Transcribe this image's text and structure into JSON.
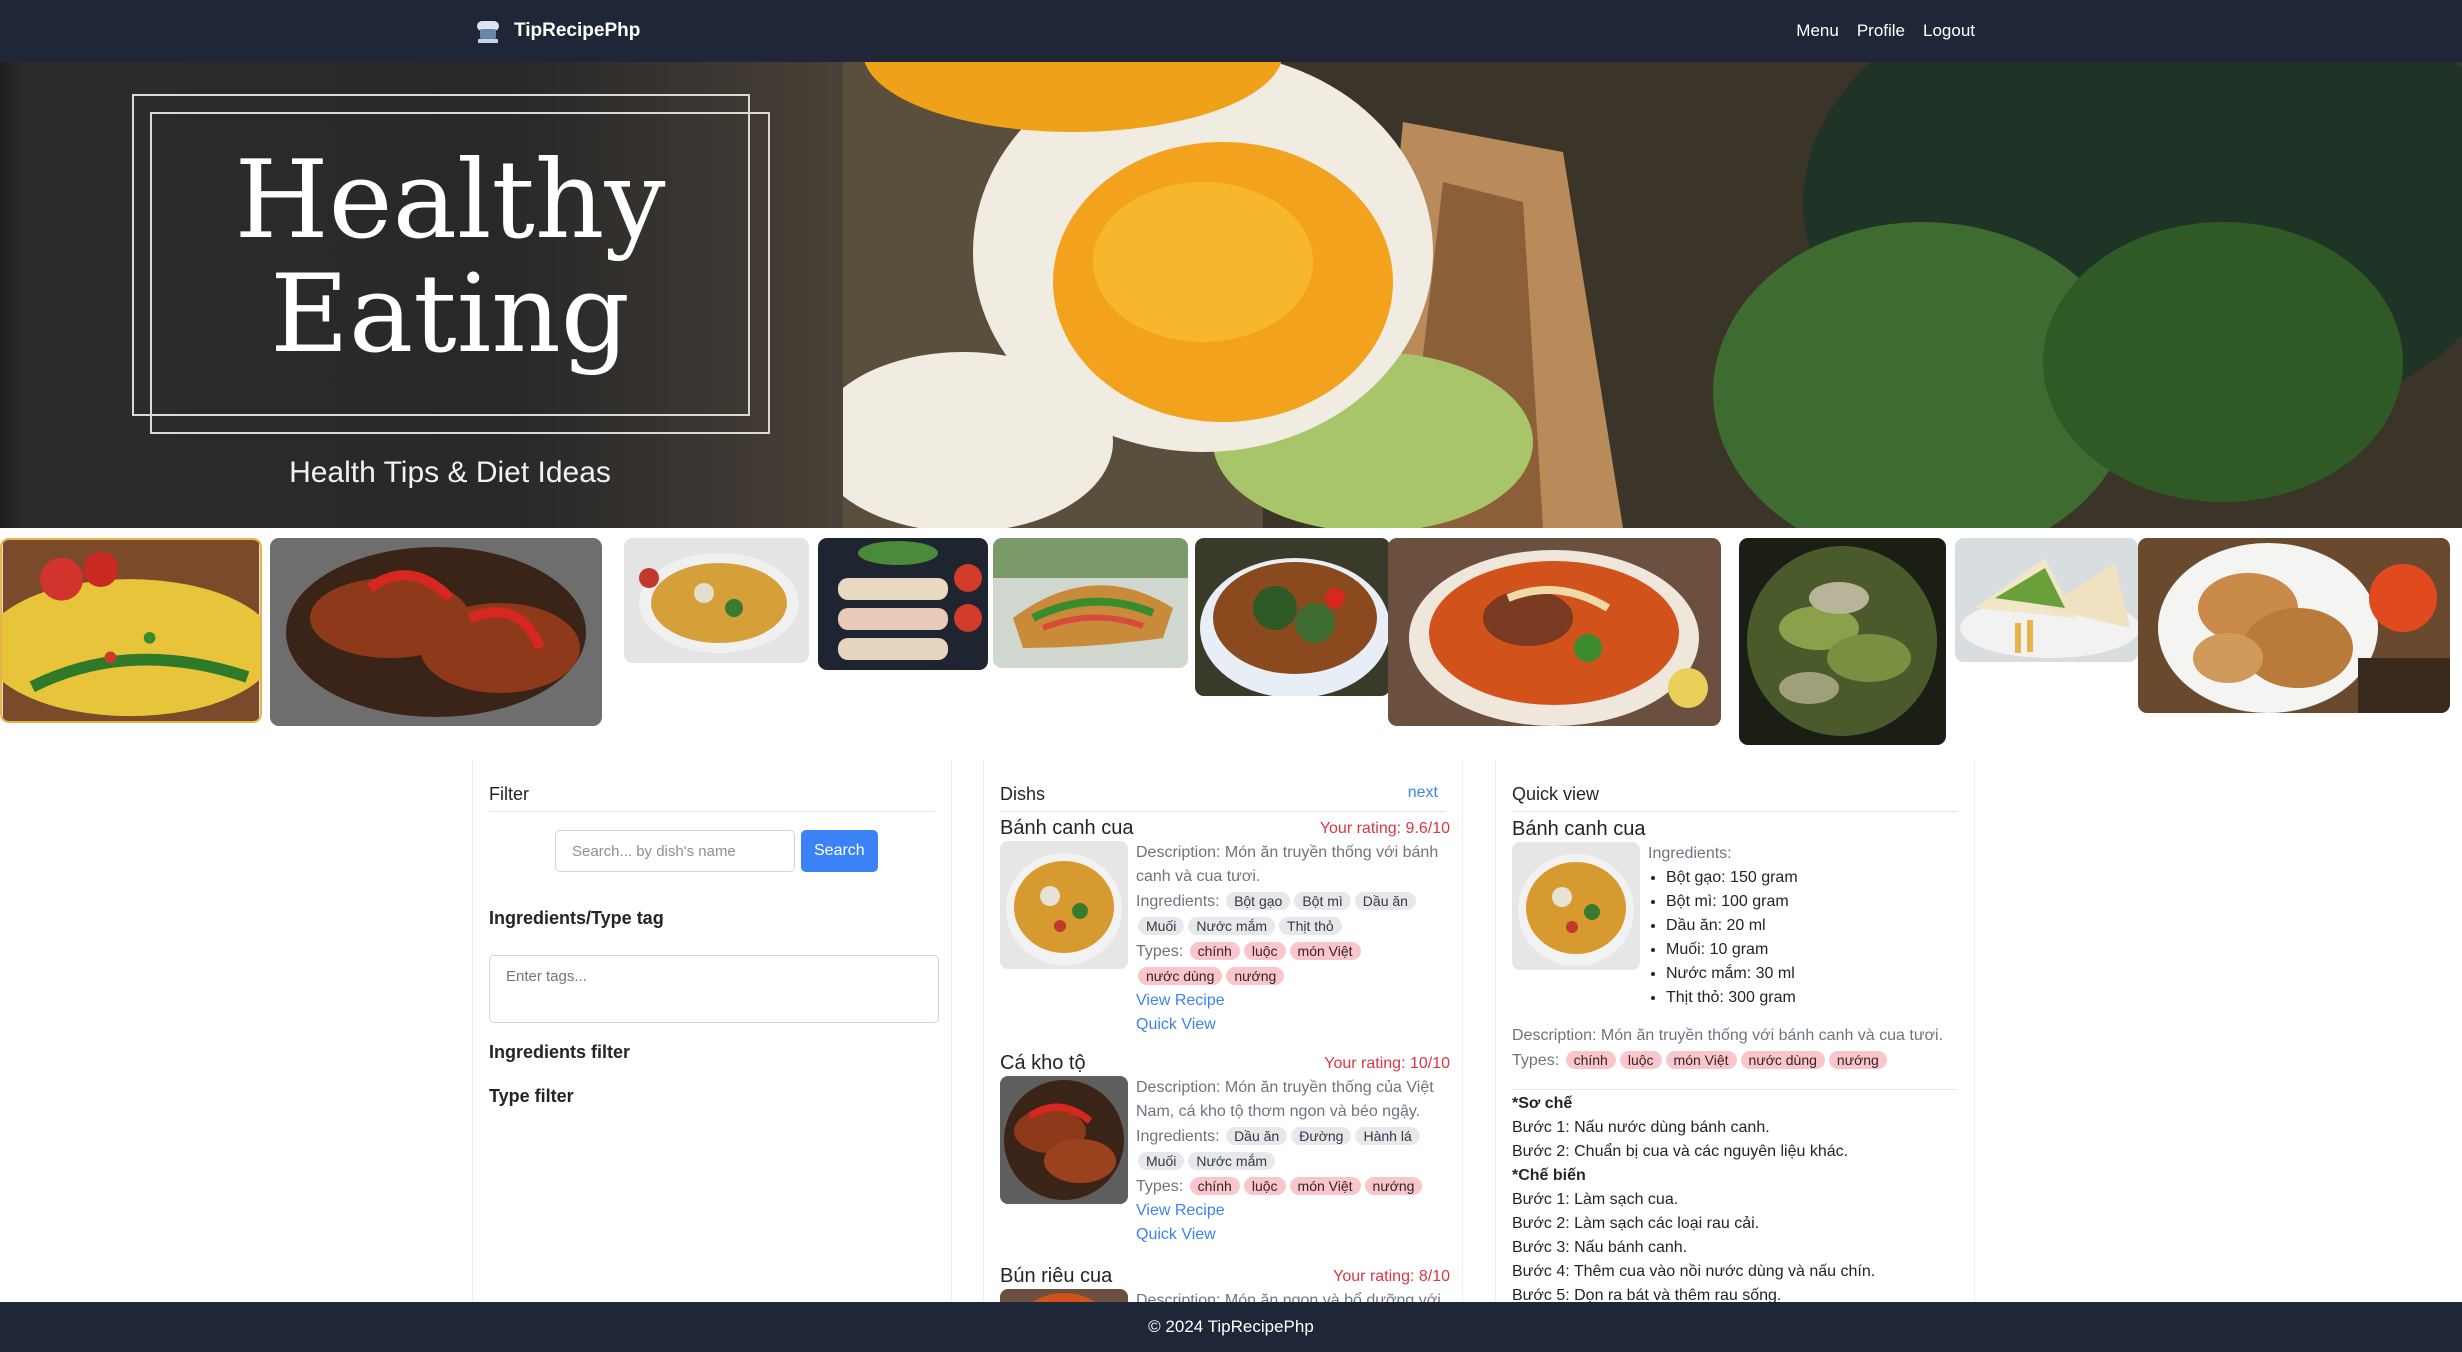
{
  "navbar": {
    "brand": "TipRecipePhp",
    "links": [
      "Menu",
      "Profile",
      "Logout"
    ]
  },
  "hero": {
    "title_line1": "Healthy",
    "title_line2": "Eating",
    "subtitle": "Health Tips & Diet Ideas"
  },
  "filter": {
    "title": "Filter",
    "search_placeholder": "Search... by dish's name",
    "search_button": "Search",
    "tags_label": "Ingredients/Type tag",
    "tags_placeholder": "Enter tags...",
    "ingredients_filter": "Ingredients filter",
    "type_filter": "Type filter"
  },
  "dishes": {
    "title": "Dishs",
    "next": "next",
    "ingredients_label": "Ingredients:",
    "types_label": "Types:",
    "view_recipe": "View Recipe",
    "quick_view": "Quick View",
    "items": [
      {
        "name": "Bánh canh cua",
        "rating": "Your rating: 9.6/10",
        "description": "Description: Món ăn truyền thống với bánh canh và cua tươi.",
        "ingredients": [
          "Bột gạo",
          "Bột mì",
          "Dầu ăn",
          "Muối",
          "Nước mắm",
          "Thịt thỏ"
        ],
        "types": [
          "chính",
          "luộc",
          "món Việt",
          "nước dùng",
          "nướng"
        ]
      },
      {
        "name": "Cá kho tộ",
        "rating": "Your rating: 10/10",
        "description": "Description: Món ăn truyền thống của Việt Nam, cá kho tộ thơm ngon và béo ngậy.",
        "ingredients": [
          "Dầu ăn",
          "Đường",
          "Hành lá",
          "Muối",
          "Nước mắm"
        ],
        "types": [
          "chính",
          "luộc",
          "món Việt",
          "nướng"
        ]
      },
      {
        "name": "Bún riêu cua",
        "rating": "Your rating: 8/10",
        "description": "Description: Món ăn ngon và bổ dưỡng với"
      }
    ]
  },
  "quick_view": {
    "title": "Quick view",
    "name": "Bánh canh cua",
    "ingredients_label": "Ingredients:",
    "ingredients": [
      "Bột gạo: 150 gram",
      "Bột mì: 100 gram",
      "Dầu ăn: 20 ml",
      "Muối: 10 gram",
      "Nước mắm: 30 ml",
      "Thịt thỏ: 300 gram"
    ],
    "description": "Description: Món ăn truyền thống với bánh canh và cua tươi.",
    "types_label": "Types:",
    "types": [
      "chính",
      "luộc",
      "món Việt",
      "nước dùng",
      "nướng"
    ],
    "prep_heading": "*Sơ chế",
    "prep_steps": [
      "Bước 1: Nấu nước dùng bánh canh.",
      "Bước 2: Chuẩn bị cua và các nguyên liệu khác."
    ],
    "cook_heading": "*Chế biến",
    "cook_steps": [
      "Bước 1: Làm sạch cua.",
      "Bước 2: Làm sạch các loại rau cải.",
      "Bước 3: Nấu bánh canh.",
      "Bước 4: Thêm cua vào nồi nước dùng và nấu chín.",
      "Bước 5: Dọn ra bát và thêm rau sống."
    ]
  },
  "footer": {
    "text": "© 2024 TipRecipePhp"
  },
  "colors": {
    "navbar": "#1f2638",
    "link": "#3b82f6",
    "rating": "#dc3545",
    "ingredient_chip": "#e6e8eb",
    "type_chip": "#f8c6cb"
  }
}
